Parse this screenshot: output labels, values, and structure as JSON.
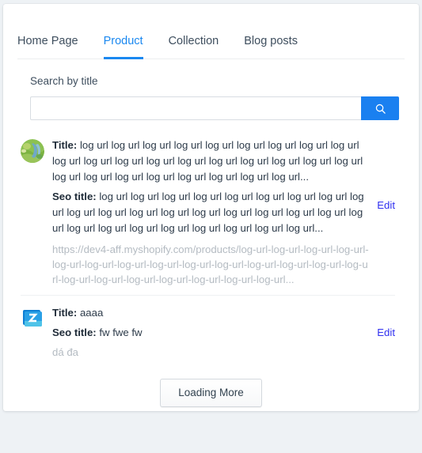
{
  "tabs": [
    {
      "label": "Home Page",
      "active": false
    },
    {
      "label": "Product",
      "active": true
    },
    {
      "label": "Collection",
      "active": false
    },
    {
      "label": "Blog posts",
      "active": false
    }
  ],
  "search": {
    "label": "Search by title",
    "value": "",
    "placeholder": "",
    "button_icon": "search-icon"
  },
  "labels": {
    "title_key": "Title:",
    "seo_key": "Seo title:",
    "edit": "Edit"
  },
  "items": [
    {
      "thumb_icon": "product-photo-thumbnail",
      "title": "log url log url log url log url log url log url log url log url log url log url log url log url log url log url log url log url log url log url log url log url log url log url log url log url log url log url log url...",
      "seo_title": "log url log url log url log url log url log url log url log url log url log url log url log url log url log url log url log url log url log url log url log url log url log url log url log url log url log url log url...",
      "url": "https://dev4-aff.myshopify.com/products/log-url-log-url-log-url-log-url-log-url-log-url-log-url-log-url-log-url-log-url-log-url-log-url-log-url-log-url-log-url-log-url-log-url-log-url-log-url-log-url-log-url...",
      "edit": "Edit"
    },
    {
      "thumb_icon": "zalo-logo-thumbnail",
      "title": "aaaa",
      "seo_title": "fw fwe fw",
      "url": "dá đa",
      "edit": "Edit"
    }
  ],
  "footer": {
    "load_more": "Loading More"
  },
  "colors": {
    "accent": "#1a88f0",
    "search_button": "#1a80f0",
    "link": "#3131f0",
    "page_bg": "#eef2f5",
    "text": "#2d3b4a",
    "muted": "#b4bbc2"
  }
}
